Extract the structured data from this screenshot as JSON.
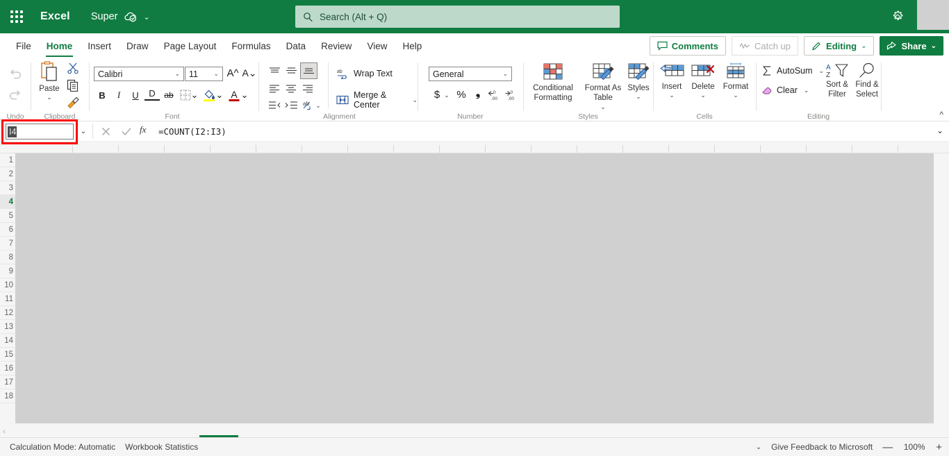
{
  "titlebar": {
    "app_launcher_icon": "waffle-grid-icon",
    "brand": "Excel",
    "document_name": "Super",
    "cloud_icon": "cloud-saved-icon",
    "title_chevron": "chevron-down-icon",
    "search": {
      "placeholder": "Search (Alt + Q)",
      "icon": "search-icon"
    },
    "settings_icon": "gear-icon",
    "accent_color": "#107c41"
  },
  "tabs": [
    {
      "label": "File",
      "active": false
    },
    {
      "label": "Home",
      "active": true
    },
    {
      "label": "Insert",
      "active": false
    },
    {
      "label": "Draw",
      "active": false
    },
    {
      "label": "Page Layout",
      "active": false
    },
    {
      "label": "Formulas",
      "active": false
    },
    {
      "label": "Data",
      "active": false
    },
    {
      "label": "Review",
      "active": false
    },
    {
      "label": "View",
      "active": false
    },
    {
      "label": "Help",
      "active": false
    }
  ],
  "tab_actions": {
    "comments": "Comments",
    "catch_up": "Catch up",
    "editing": "Editing",
    "share": "Share",
    "chevron": "⌄"
  },
  "ribbon": {
    "undo": {
      "group_label": "Undo",
      "undo_icon": "undo-arrow-icon",
      "redo_icon": "redo-arrow-icon"
    },
    "clipboard": {
      "group_label": "Clipboard",
      "paste_label": "Paste",
      "paste_icon": "clipboard-paste-icon",
      "cut_icon": "scissors-icon",
      "copy_icon": "copy-icon",
      "format_painter_icon": "format-painter-icon"
    },
    "font": {
      "group_label": "Font",
      "font_name": "Calibri",
      "font_size": "11",
      "grow_font": "A^",
      "shrink_font": "A⌄",
      "bold": "B",
      "italic": "I",
      "underline": "U",
      "double_underline": "D",
      "strikethrough": "ab",
      "borders_icon": "borders-icon",
      "fill_color_icon": "fill-color-icon",
      "font_color_icon": "font-color-icon",
      "fill_color": "#ffff00",
      "font_color": "#c00000"
    },
    "alignment": {
      "group_label": "Alignment",
      "align_top_icon": "align-top-icon",
      "align_middle_icon": "align-middle-icon",
      "align_bottom_icon": "align-bottom-icon",
      "align_left_icon": "align-left-icon",
      "align_center_icon": "align-center-icon",
      "align_right_icon": "align-right-icon",
      "decrease_indent_icon": "decrease-indent-icon",
      "increase_indent_icon": "increase-indent-icon",
      "orientation_icon": "text-orientation-icon",
      "wrap_text": "Wrap Text",
      "wrap_text_icon": "wrap-text-icon",
      "merge_center": "Merge & Center",
      "merge_center_icon": "merge-cells-icon"
    },
    "number": {
      "group_label": "Number",
      "format": "General",
      "currency": "$",
      "percent": "%",
      "comma": "❟",
      "decrease_decimal_icon": "decrease-decimal-icon",
      "increase_decimal_icon": "increase-decimal-icon"
    },
    "styles": {
      "group_label": "Styles",
      "conditional_formatting": "Conditional Formatting",
      "format_as_table": "Format As Table",
      "cell_styles": "Styles"
    },
    "cells": {
      "group_label": "Cells",
      "insert": "Insert",
      "delete": "Delete",
      "format": "Format"
    },
    "editing": {
      "group_label": "Editing",
      "autosum": "AutoSum",
      "autosum_icon": "sigma-icon",
      "clear": "Clear",
      "clear_icon": "eraser-icon",
      "sort_filter": "Sort & Filter",
      "sort_filter_icon": "sort-filter-icon",
      "find_select": "Find & Select",
      "find_select_icon": "magnifier-icon"
    },
    "collapse_icon": "chevron-up-icon"
  },
  "formula_bar": {
    "name_box_value": "I4",
    "name_box_highlighted": true,
    "name_box_outline_color": "#ff0000",
    "name_box_chevron": "chevron-down-icon",
    "cancel_icon": "cancel-x-icon",
    "enter_icon": "confirm-check-icon",
    "insert_function_icon": "fx-icon",
    "insert_function_label": "fx",
    "formula": "=COUNT(I2:I3)",
    "expand_icon": "chevron-down-icon"
  },
  "grid": {
    "rows": [
      "1",
      "2",
      "3",
      "4",
      "5",
      "6",
      "7",
      "8",
      "9",
      "10",
      "11",
      "12",
      "13",
      "14",
      "15",
      "16",
      "17",
      "18"
    ],
    "active_row": "4",
    "sheet_prev_icon": "chevron-left-icon",
    "overlay_color": "#d0d0d0"
  },
  "status_bar": {
    "calculation_mode": "Calculation Mode: Automatic",
    "workbook_statistics": "Workbook Statistics",
    "chevron": "⌄",
    "feedback": "Give Feedback to Microsoft",
    "zoom_out": "—",
    "zoom_level": "100%",
    "zoom_in": "+"
  }
}
